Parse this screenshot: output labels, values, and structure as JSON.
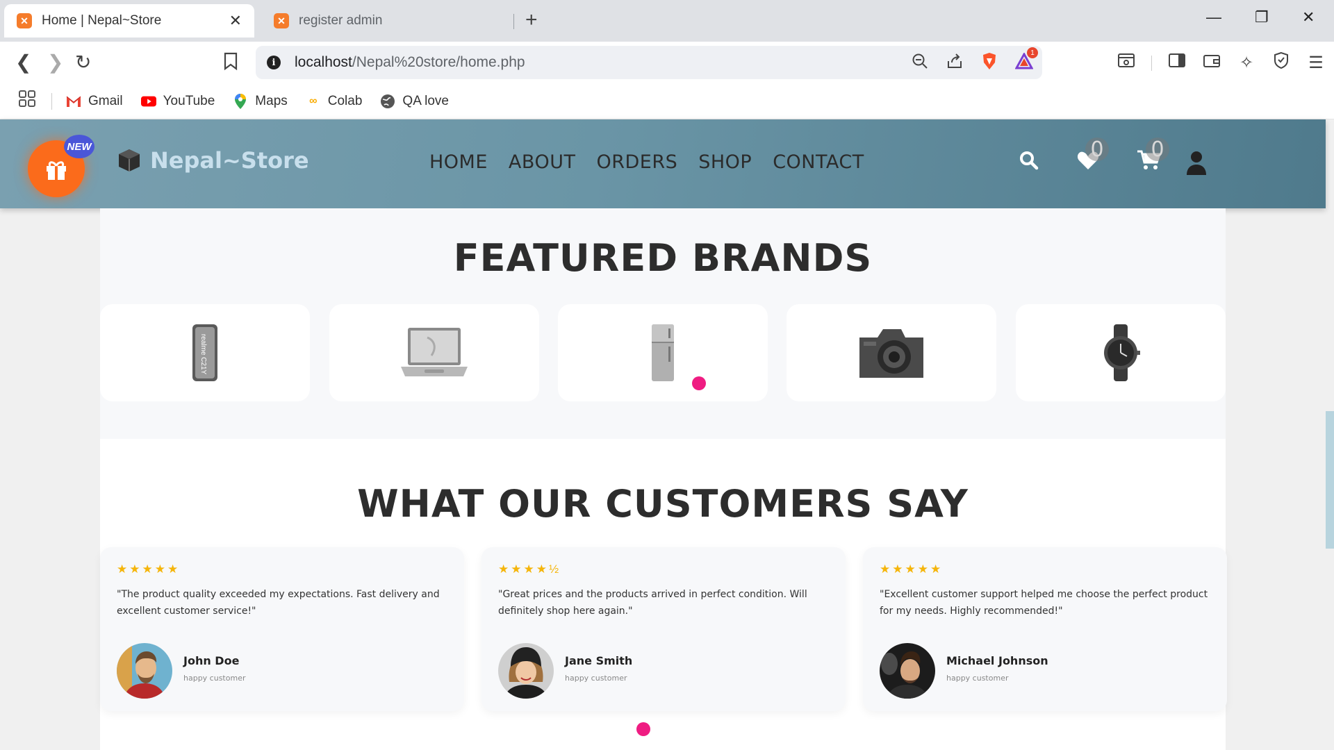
{
  "browser": {
    "tabs": [
      {
        "title": "Home | Nepal~Store",
        "active": true
      },
      {
        "title": "register admin",
        "active": false
      }
    ],
    "url_host": "localhost",
    "url_path": "/Nepal%20store/home.php",
    "rewards_badge": "1",
    "bookmarks": [
      {
        "label": "Gmail",
        "icon": "gmail-icon"
      },
      {
        "label": "YouTube",
        "icon": "youtube-icon"
      },
      {
        "label": "Maps",
        "icon": "maps-icon"
      },
      {
        "label": "Colab",
        "icon": "colab-icon"
      },
      {
        "label": "QA love",
        "icon": "globe-icon"
      }
    ]
  },
  "header": {
    "new_badge": "NEW",
    "logo_text": "Nepal~Store",
    "nav": [
      "HOME",
      "ABOUT",
      "ORDERS",
      "SHOP",
      "CONTACT"
    ],
    "wishlist_count": "0",
    "cart_count": "0"
  },
  "featured": {
    "title": "FEATURED BRANDS",
    "items": [
      {
        "icon": "phone-icon"
      },
      {
        "icon": "laptop-icon"
      },
      {
        "icon": "refrigerator-icon"
      },
      {
        "icon": "camera-icon"
      },
      {
        "icon": "watch-icon"
      }
    ]
  },
  "testimonials": {
    "title": "WHAT OUR CUSTOMERS SAY",
    "reviews": [
      {
        "stars": "★★★★★",
        "rating": 5,
        "text": "\"The product quality exceeded my expectations. Fast delivery and excellent customer service!\"",
        "name": "John Doe",
        "role": "happy customer"
      },
      {
        "stars": "★★★★½",
        "rating": 4.5,
        "text": "\"Great prices and the products arrived in perfect condition. Will definitely shop here again.\"",
        "name": "Jane Smith",
        "role": "happy customer"
      },
      {
        "stars": "★★★★★",
        "rating": 5,
        "text": "\"Excellent customer support helped me choose the perfect product for my needs. Highly recommended!\"",
        "name": "Michael Johnson",
        "role": "happy customer"
      }
    ]
  },
  "colors": {
    "header_bg": "#6a95a6",
    "accent_orange": "#fb6b1b",
    "accent_pink": "#ef1c82",
    "star_color": "#f5b50a"
  }
}
